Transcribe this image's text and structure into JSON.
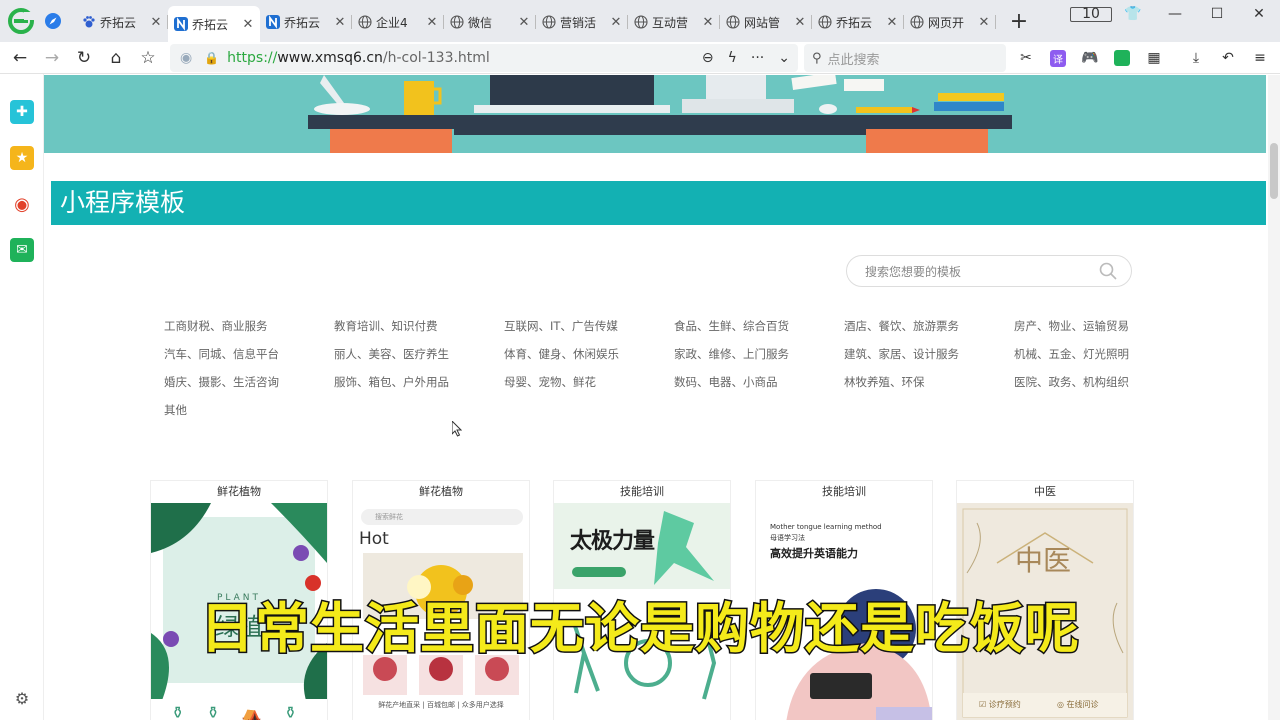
{
  "browser": {
    "tabs": [
      {
        "label": "乔拓云",
        "icon": "baidu-paw-icon"
      },
      {
        "label": "乔拓云",
        "icon": "n-logo-icon",
        "active": true
      },
      {
        "label": "乔拓云",
        "icon": "n-logo-icon"
      },
      {
        "label": "企业4",
        "icon": "globe-icon"
      },
      {
        "label": "微信",
        "icon": "globe-icon"
      },
      {
        "label": "营销活",
        "icon": "globe-icon"
      },
      {
        "label": "互动营",
        "icon": "globe-icon"
      },
      {
        "label": "网站管",
        "icon": "globe-icon"
      },
      {
        "label": "乔拓云",
        "icon": "globe-icon"
      },
      {
        "label": "网页开",
        "icon": "globe-icon"
      }
    ],
    "tab_count": "10",
    "address": {
      "scheme": "https://",
      "host": "www.xmsq6.cn",
      "path": "/h-col-133.html"
    },
    "search_placeholder": "点此搜索",
    "accent": "#13b1b3"
  },
  "page": {
    "section_title": "小程序模板",
    "template_search_placeholder": "搜索您想要的模板",
    "categories": [
      "工商财税、商业服务",
      "教育培训、知识付费",
      "互联网、IT、广告传媒",
      "食品、生鲜、综合百货",
      "酒店、餐饮、旅游票务",
      "房产、物业、运输贸易",
      "汽车、同城、信息平台",
      "丽人、美容、医疗养生",
      "体育、健身、休闲娱乐",
      "家政、维修、上门服务",
      "建筑、家居、设计服务",
      "机械、五金、灯光照明",
      "婚庆、摄影、生活咨询",
      "服饰、箱包、户外用品",
      "母婴、宠物、鲜花",
      "数码、电器、小商品",
      "林牧养殖、环保",
      "医院、政务、机构组织",
      "其他"
    ],
    "cards": [
      {
        "title": "鲜花植物",
        "img_text": "绿植",
        "img_sub": "PLANT"
      },
      {
        "title": "鲜花植物",
        "img_text": "Hot",
        "img_sub": "搜索鲜花",
        "img_foot": "鲜花产地直采 | 百城包邮 | 众多用户选择"
      },
      {
        "title": "技能培训",
        "img_text": "太极力量"
      },
      {
        "title": "技能培训",
        "img_text": "高效提升英语能力",
        "img_sub": "Mother tongue learning method",
        "img_sub2": "母语学习法"
      },
      {
        "title": "中医",
        "img_text": "中医",
        "img_foot1": "诊疗预约",
        "img_foot2": "在线问诊"
      }
    ]
  },
  "subtitle": "日常生活里面无论是购物还是吃饭呢"
}
